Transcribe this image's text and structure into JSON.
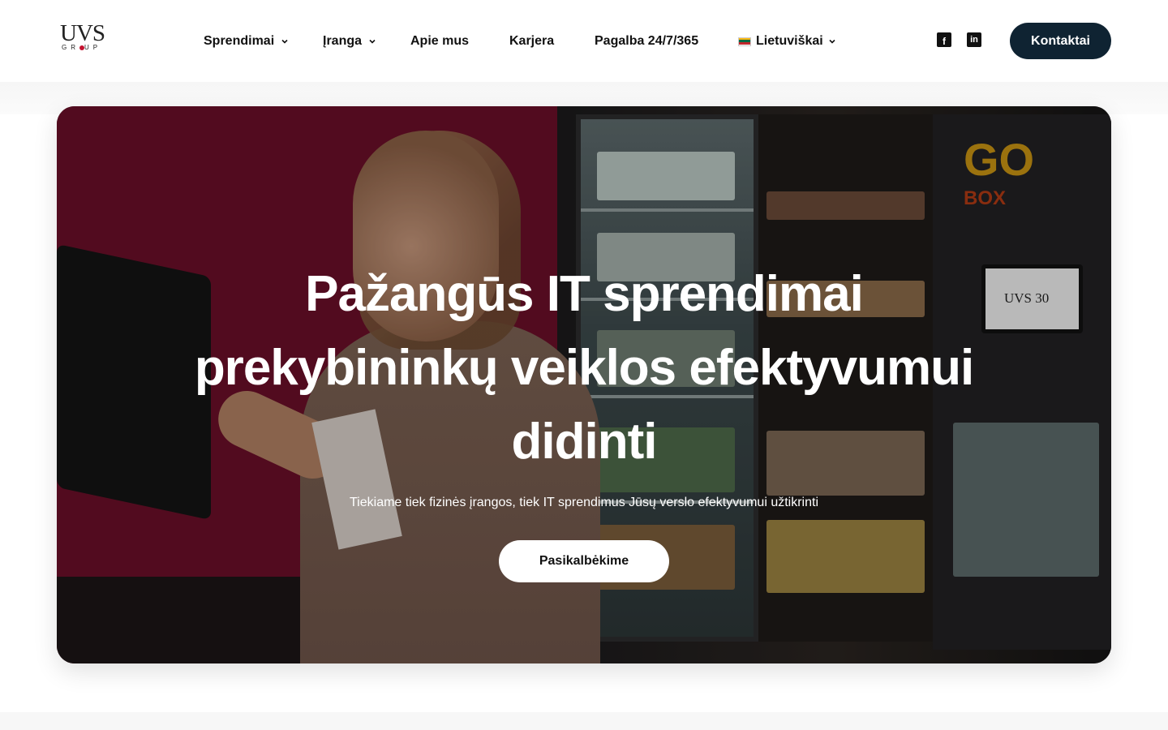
{
  "header": {
    "logo": {
      "main": "UVS",
      "sub_left": "GR",
      "sub_right": "UP"
    },
    "nav": [
      {
        "label": "Sprendimai",
        "has_dropdown": true
      },
      {
        "label": "Įranga",
        "has_dropdown": true
      },
      {
        "label": "Apie mus",
        "has_dropdown": false
      },
      {
        "label": "Karjera",
        "has_dropdown": false
      },
      {
        "label": "Pagalba 24/7/365",
        "has_dropdown": false
      }
    ],
    "language": {
      "label": "Lietuviškai",
      "flag_colors": [
        "#fdb913",
        "#006a44",
        "#c1272d"
      ]
    },
    "social": [
      {
        "icon": "facebook-icon",
        "glyph": "f"
      },
      {
        "icon": "linkedin-icon",
        "glyph": "in"
      }
    ],
    "contact_button": "Kontaktai"
  },
  "hero": {
    "title": "Pažangūs IT sprendimai prekybininkų veiklos efektyvumui didinti",
    "subtitle": "Tiekiame tiek fizinės įrangos, tiek IT sprendimus Jūsų verslo efektyvumui užtikrinti",
    "button": "Pasikalbėkime",
    "image": {
      "vending_brand": "GO BOX",
      "vending_brand_top": "GO",
      "vending_brand_bottom": "BOX",
      "screen_text": "UVS 30"
    }
  },
  "colors": {
    "accent_dark": "#0f2332",
    "hero_maroon": "#6a0f28",
    "logo_red": "#c4122f"
  }
}
